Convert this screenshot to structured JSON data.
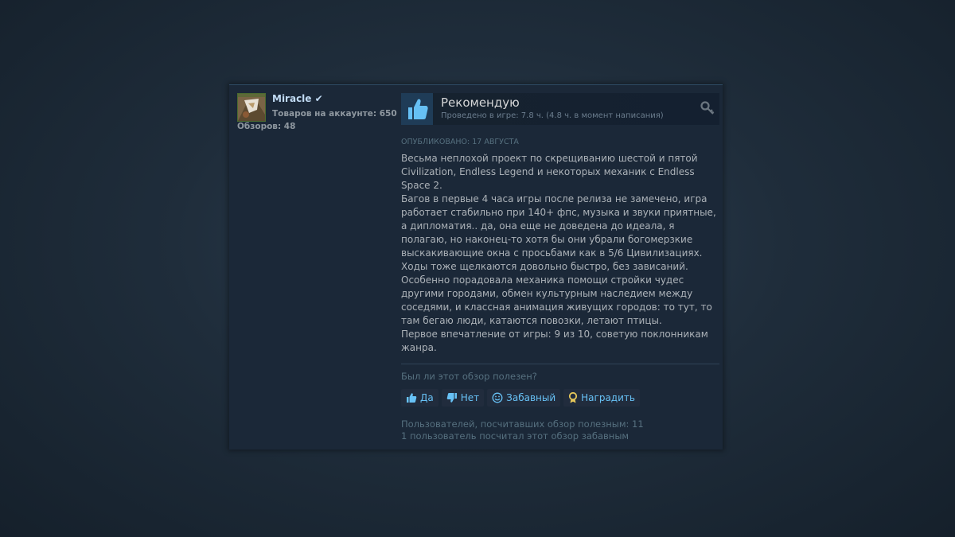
{
  "author": {
    "name": "Miracle",
    "verified_mark": "✔",
    "products_label": "Товаров на аккаунте: 650",
    "reviews_label": "Обзоров: 48"
  },
  "review": {
    "verdict": "Рекомендую",
    "playtime": "Проведено в игре: 7.8 ч. (4.8 ч. в момент написания)",
    "posted": "ОПУБЛИКОВАНО: 17 АВГУСТА",
    "body_lines": [
      "Весьма неплохой проект по скрещиванию шестой и пятой Civilization, Endless Legend и некоторых механик с Endless Space 2.",
      "Багов в первые 4 часа игры после релиза не замечено, игра работает стабильно при 140+ фпс, музыка и звуки приятные, а дипломатия.. да, она еще не доведена до идеала, я полагаю, но наконец-то хотя бы они убрали богомерзкие выскакивающие окна с просьбами как в 5/6 Цивилизациях.",
      "Ходы тоже щелкаются довольно быстро, без зависаний.",
      "Особенно порадовала механика помощи стройки чудес другими городами, обмен культурным наследием между соседями, и классная анимация живущих городов: то тут, то там бегаю люди, катаются повозки, летают птицы.",
      "Первое впечатление от игры: 9 из 10, советую поклонникам жанра."
    ]
  },
  "feedback": {
    "question": "Был ли этот обзор полезен?",
    "yes": "Да",
    "no": "Нет",
    "funny": "Забавный",
    "award": "Наградить",
    "helpful_count": "Пользователей, посчитавших обзор полезным: 11",
    "funny_count": "1 пользователь посчитал этот обзор забавным"
  },
  "icons": {
    "thumb_up": "thumbs-up-icon",
    "thumb_down": "thumbs-down-icon",
    "funny": "smiley-icon",
    "award": "award-icon",
    "key": "key-icon"
  },
  "colors": {
    "accent": "#67c1f5",
    "thumb_up": "#66c0f4",
    "award": "#e5c75a"
  }
}
